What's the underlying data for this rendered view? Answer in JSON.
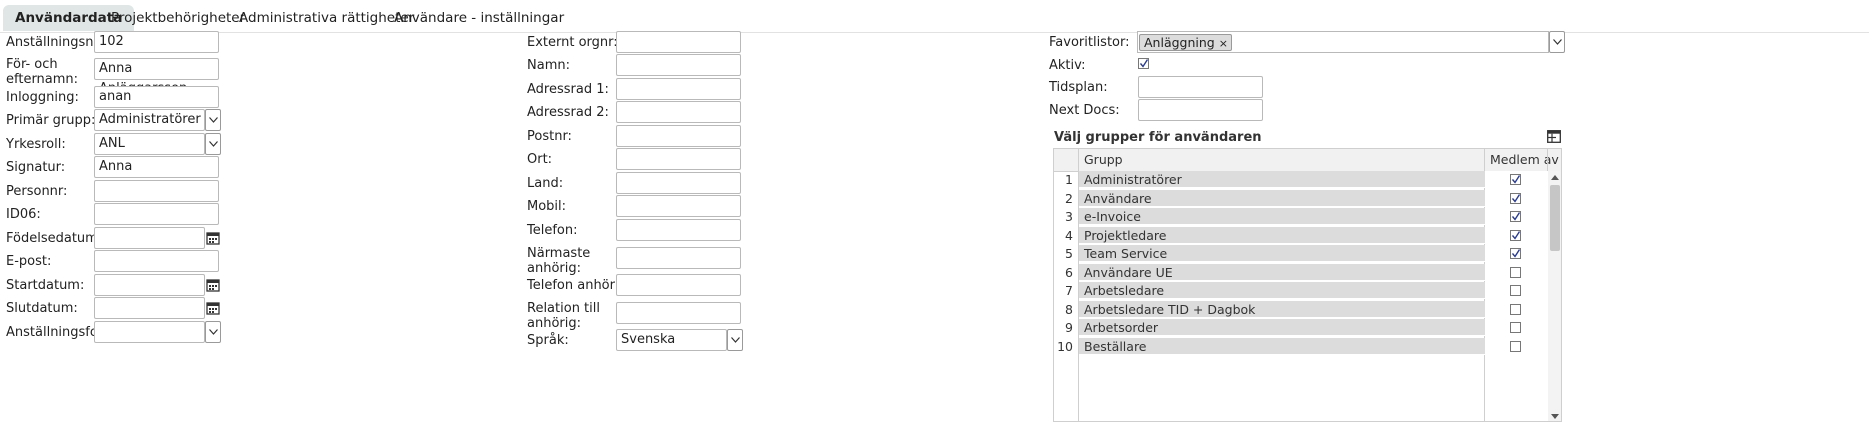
{
  "tabs": [
    "Användardata",
    "Projektbehörigheter",
    "Administrativa rättigheter",
    "Användare - inställningar"
  ],
  "left": {
    "employee_no_label": "Anställningsnr:",
    "employee_no": "102",
    "name_label": "För- och efternamn:",
    "name": "Anna Anläggarsson",
    "login_label": "Inloggning:",
    "login": "anan",
    "primary_group_label": "Primär grupp:",
    "primary_group": "Administratörer",
    "role_label": "Yrkesroll:",
    "role": "ANL",
    "signature_label": "Signatur:",
    "signature": "Anna Anläggarsson",
    "personnr_label": "Personnr:",
    "personnr": "",
    "id06_label": "ID06:",
    "id06": "",
    "birthdate_label": "Födelsedatum:",
    "birthdate": "",
    "email_label": "E-post:",
    "email": "",
    "startdate_label": "Startdatum:",
    "startdate": "",
    "enddate_label": "Slutdatum:",
    "enddate": "",
    "employment_form_label": "Anställningsform",
    "employment_form": ""
  },
  "middle": {
    "ext_org_label": "Externt orgnr:",
    "name_label": "Namn:",
    "addr1_label": "Adressrad 1:",
    "addr2_label": "Adressrad 2:",
    "postnr_label": "Postnr:",
    "city_label": "Ort:",
    "country_label": "Land:",
    "mobile_label": "Mobil:",
    "phone_label": "Telefon:",
    "relative_label": "Närmaste anhörig:",
    "relative_phone_label": "Telefon anhörig:",
    "relation_label": "Relation till anhörig:",
    "language_label": "Språk:",
    "language": "Svenska"
  },
  "right": {
    "favorites_label": "Favoritlistor:",
    "favorite_chip": "Anläggning",
    "chip_remove": "×",
    "active_label": "Aktiv:",
    "active": true,
    "schedule_label": "Tidsplan:",
    "schedule": "",
    "nextdocs_label": "Next Docs:",
    "nextdocs": ""
  },
  "groups": {
    "title": "Välj grupper för användaren",
    "col_group": "Grupp",
    "col_member": "Medlem av",
    "rows": [
      {
        "n": "1",
        "name": "Administratörer",
        "member": true
      },
      {
        "n": "2",
        "name": "Användare",
        "member": true
      },
      {
        "n": "3",
        "name": "e-Invoice",
        "member": true
      },
      {
        "n": "4",
        "name": "Projektledare",
        "member": true
      },
      {
        "n": "5",
        "name": "Team Service",
        "member": true
      },
      {
        "n": "6",
        "name": "Användare UE",
        "member": false
      },
      {
        "n": "7",
        "name": "Arbetsledare",
        "member": false
      },
      {
        "n": "8",
        "name": "Arbetsledare TID + Dagbok",
        "member": false
      },
      {
        "n": "9",
        "name": "Arbetsorder",
        "member": false
      },
      {
        "n": "10",
        "name": "Beställare",
        "member": false
      }
    ]
  }
}
